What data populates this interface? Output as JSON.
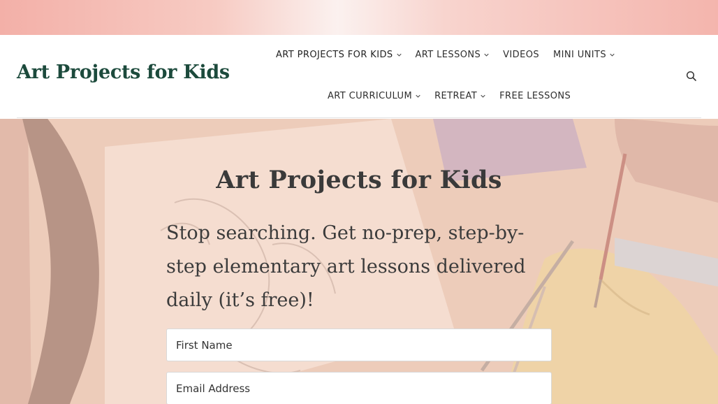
{
  "header": {
    "logo_text": "Art Projects for Kids",
    "nav_row1": [
      {
        "label": "ART PROJECTS FOR KIDS",
        "has_dropdown": true
      },
      {
        "label": "ART LESSONS",
        "has_dropdown": true
      },
      {
        "label": "VIDEOS",
        "has_dropdown": false
      },
      {
        "label": "MINI UNITS",
        "has_dropdown": true
      }
    ],
    "nav_row2": [
      {
        "label": "ART CURRICULUM",
        "has_dropdown": true
      },
      {
        "label": "RETREAT",
        "has_dropdown": true
      },
      {
        "label": "FREE LESSONS",
        "has_dropdown": false
      }
    ],
    "search_icon": "search-icon"
  },
  "hero": {
    "title": "Art Projects for Kids",
    "subtitle": "Stop searching. Get no-prep, step-by-step elementary art lessons delivered daily (it’s free)!",
    "first_name_placeholder": "First Name",
    "email_placeholder": "Email Address"
  },
  "colors": {
    "banner_pink": "#f3b0a8",
    "logo_green": "#1c4a3c",
    "hero_tint": "#f5d6c8"
  }
}
